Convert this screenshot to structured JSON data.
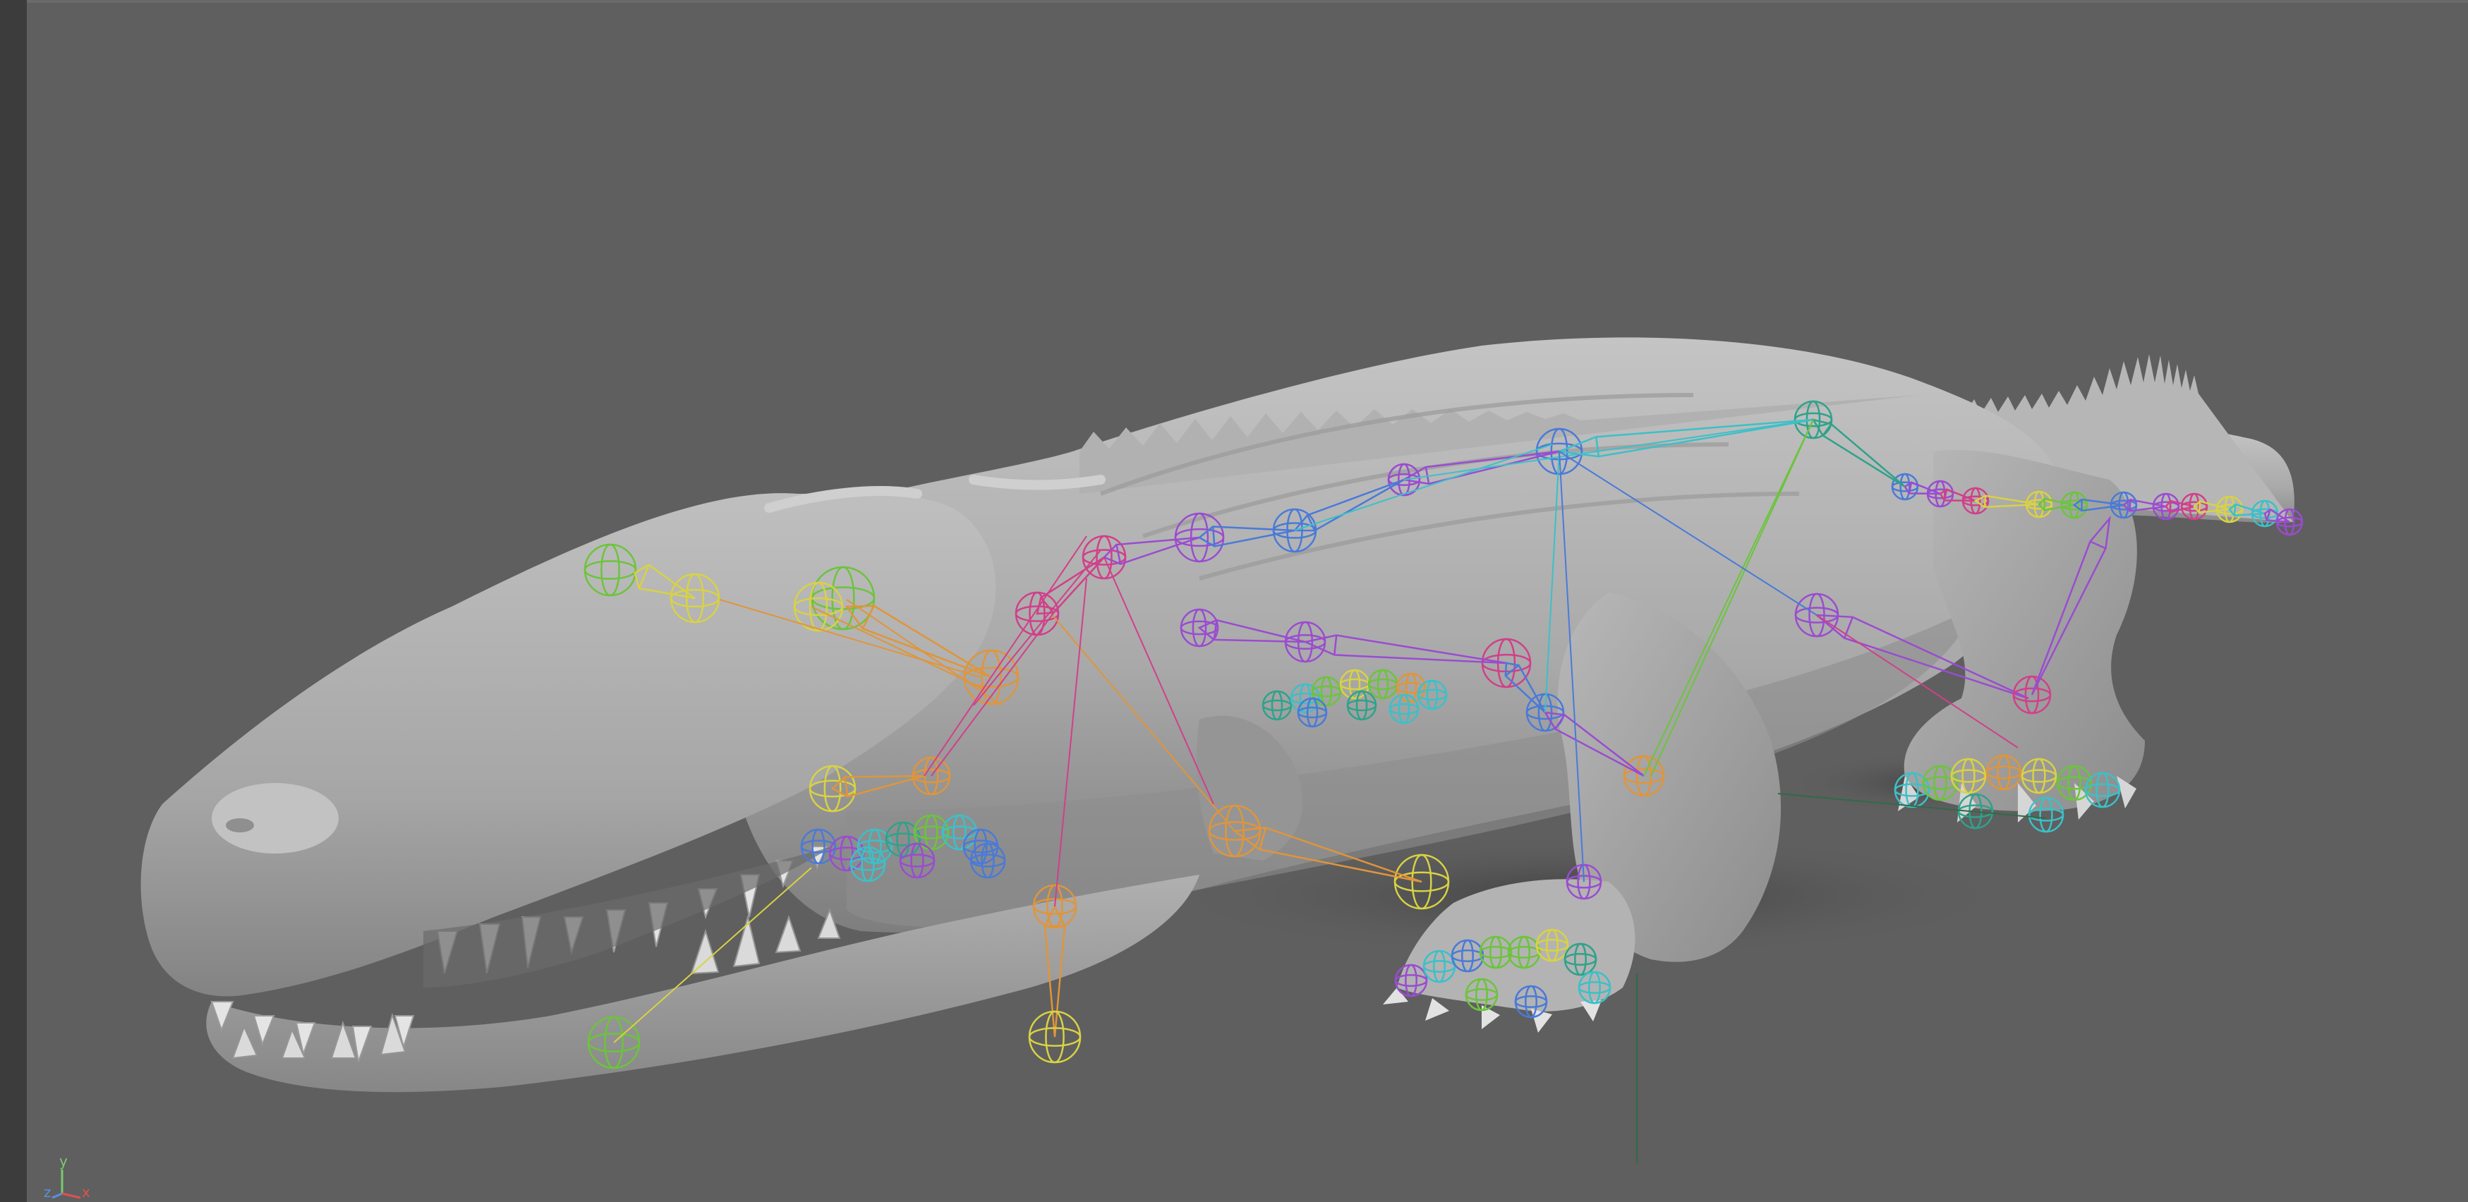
{
  "viewport": {
    "background": "#5f5f5f",
    "model": "crocodile-mesh",
    "display_mode": "smooth-shaded",
    "rig_visible": true
  },
  "axis_gizmo": {
    "y_label": "y",
    "z_label": "z",
    "x_label": "x",
    "y_color": "#7ec86e",
    "z_color": "#5a8fe0",
    "x_color": "#e05050"
  },
  "rig_colors": {
    "green": "#6cc43c",
    "yellow": "#d8d244",
    "orange": "#e0953a",
    "magenta": "#d0408a",
    "purple": "#9a4cd0",
    "blue": "#4a7ad8",
    "cyan": "#3cc0c8",
    "teal": "#2fa28a"
  },
  "mesh_colors": {
    "body_light": "#bdbdbd",
    "body_mid": "#a3a3a3",
    "body_dark": "#7c7c7c",
    "shadow": "#505050"
  }
}
